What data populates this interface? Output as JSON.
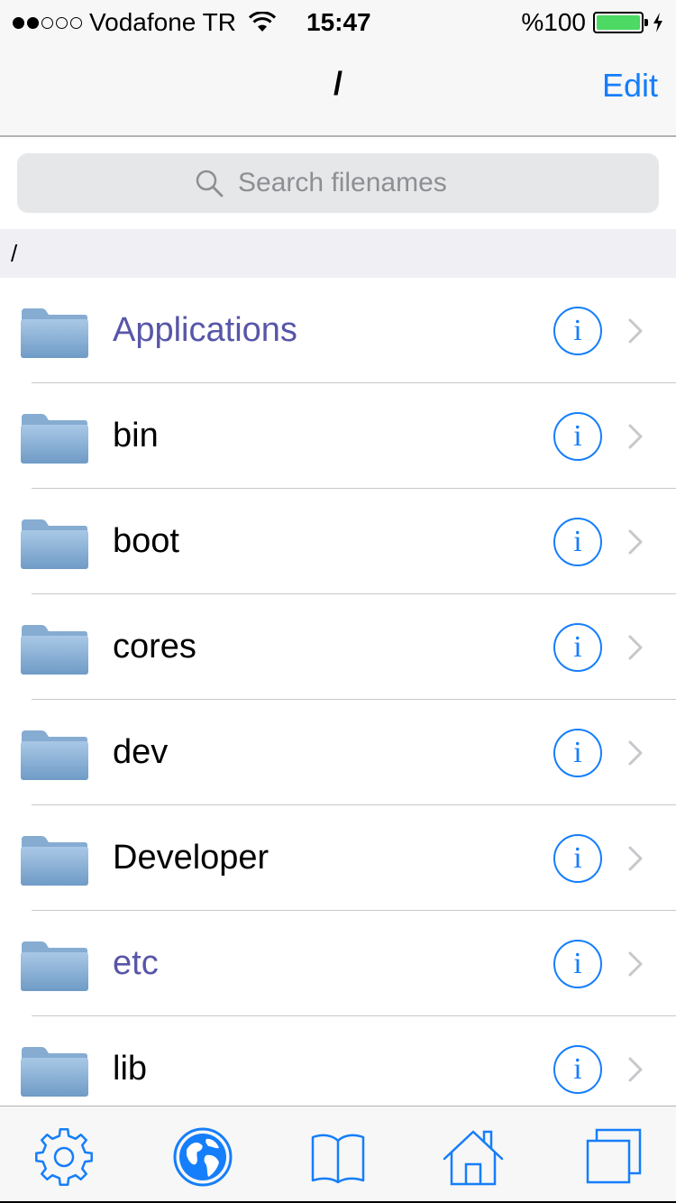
{
  "status_bar": {
    "carrier": "Vodafone TR",
    "time": "15:47",
    "battery": "%100",
    "signal_bars": 2,
    "signal_total": 5
  },
  "nav": {
    "title": "/",
    "edit_label": "Edit"
  },
  "search": {
    "placeholder": "Search filenames"
  },
  "path_header": "/",
  "items": [
    {
      "label": "Applications",
      "special": true
    },
    {
      "label": "bin",
      "special": false
    },
    {
      "label": "boot",
      "special": false
    },
    {
      "label": "cores",
      "special": false
    },
    {
      "label": "dev",
      "special": false
    },
    {
      "label": "Developer",
      "special": false
    },
    {
      "label": "etc",
      "special": true
    },
    {
      "label": "lib",
      "special": false
    }
  ],
  "info_glyph": "i",
  "tabs": [
    {
      "icon": "gear-icon"
    },
    {
      "icon": "globe-icon"
    },
    {
      "icon": "book-icon"
    },
    {
      "icon": "home-icon"
    },
    {
      "icon": "windows-icon"
    }
  ],
  "colors": {
    "accent": "#157efb",
    "special_text": "#5856a8",
    "battery": "#4cd964"
  }
}
